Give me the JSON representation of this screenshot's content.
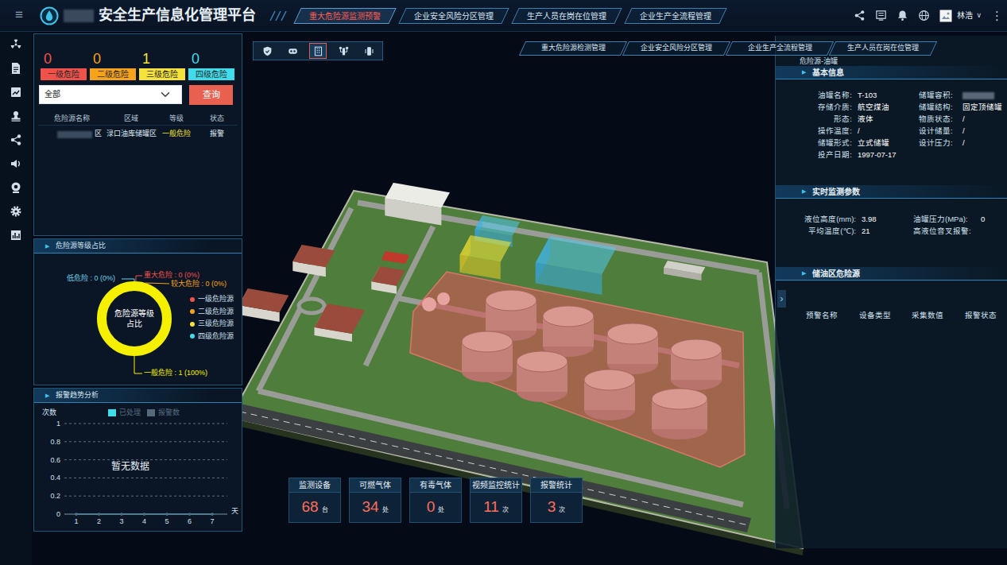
{
  "header": {
    "menu_icon": "≡",
    "title_redacted": true,
    "title": "安全生产信息化管理平台",
    "user": "林浩",
    "user_caret": "∨",
    "more_icon": "⋮"
  },
  "nav_tabs": [
    {
      "label": "重大危险源监测预警",
      "selected": true
    },
    {
      "label": "企业安全风险分区管理",
      "selected": false
    },
    {
      "label": "生产人员在岗在位管理",
      "selected": false
    },
    {
      "label": "企业生产全流程管理",
      "selected": false
    }
  ],
  "section_marker": "▶",
  "risk_counts": [
    {
      "count": "0",
      "label": "一级危险",
      "color": "#f0524a"
    },
    {
      "count": "0",
      "label": "二级危险",
      "color": "#f7a21b"
    },
    {
      "count": "1",
      "label": "三级危险",
      "color": "#f5e23a"
    },
    {
      "count": "0",
      "label": "四级危险",
      "color": "#3fdcec"
    }
  ],
  "filter": {
    "value": "全部",
    "button": "查询"
  },
  "risk_table": {
    "columns": [
      "危险源名称",
      "区域",
      "等级",
      "状态"
    ],
    "rows": [
      {
        "name_redacted": true,
        "cells": [
          "区",
          "渌口油库储罐区",
          "一般危险",
          "报警"
        ],
        "color": "#f5e23a"
      }
    ]
  },
  "ratio_chart": {
    "title": "危险源等级占比",
    "center": [
      "危险源等级",
      "占比"
    ],
    "segments": [
      {
        "label": "低危险 : 0 (0%)",
        "value": 0,
        "color": "#6fd3e6"
      },
      {
        "label": "重大危险 : 0 (0%)",
        "value": 0,
        "color": "#f0524a"
      },
      {
        "label": "较大危险 : 0 (0%)",
        "value": 0,
        "color": "#f7a21b"
      },
      {
        "label": "一般危险 : 1 (100%)",
        "value": 1,
        "color": "#f5f000"
      }
    ],
    "legend": [
      {
        "label": "一级危险源",
        "color": "#f0524a"
      },
      {
        "label": "二级危险源",
        "color": "#f7a21b"
      },
      {
        "label": "三级危险源",
        "color": "#f5e23a"
      },
      {
        "label": "四级危险源",
        "color": "#3fdcec"
      }
    ]
  },
  "trend_chart": {
    "title": "报警趋势分析",
    "y_label": "次数",
    "y_ticks": [
      "1",
      "0.8",
      "0.6",
      "0.4",
      "0.2",
      "0"
    ],
    "x_ticks": [
      "1",
      "2",
      "3",
      "4",
      "5",
      "6",
      "7"
    ],
    "x_unit": "天",
    "empty_text": "暂无数据",
    "series": [
      {
        "name": "已处理",
        "color": "#3fdcec",
        "values": [
          0,
          0,
          0,
          0,
          0,
          0,
          0
        ]
      },
      {
        "name": "报警数",
        "color": "#56697c",
        "values": [
          0,
          0,
          0,
          0,
          0,
          0,
          0
        ]
      }
    ]
  },
  "toolbar": [
    {
      "selected": false
    },
    {
      "selected": false
    },
    {
      "selected": true
    },
    {
      "selected": false
    },
    {
      "selected": false
    }
  ],
  "sub_tabs": [
    "重大危险源检测管理",
    "企业安全风险分区管理",
    "企业生产全流程管理",
    "生产人员在岗在位管理"
  ],
  "detail": {
    "title": "危险源-油罐",
    "handle": "›",
    "basic": {
      "title": "基本信息",
      "fields": [
        {
          "label": "油罐名称:",
          "value": "T-103",
          "redacted": false
        },
        {
          "label": "储罐容积:",
          "value": "",
          "redacted": true
        },
        {
          "label": "存储介质:",
          "value": "航空煤油",
          "redacted": false
        },
        {
          "label": "储罐结构:",
          "value": "固定顶储罐",
          "redacted": false
        },
        {
          "label": "形态:",
          "value": "液体",
          "redacted": false
        },
        {
          "label": "物质状态:",
          "value": "/",
          "redacted": false
        },
        {
          "label": "操作温度:",
          "value": "/",
          "redacted": false
        },
        {
          "label": "设计储量:",
          "value": "/",
          "redacted": false
        },
        {
          "label": "储罐形式:",
          "value": "立式储罐",
          "redacted": false
        },
        {
          "label": "设计压力:",
          "value": "/",
          "redacted": false
        },
        {
          "label": "投产日期:",
          "value": "1997-07-17",
          "redacted": false
        }
      ]
    },
    "monitor": {
      "title": "实时监测参数",
      "fields": [
        {
          "label": "液位高度(mm):",
          "value": "3.98"
        },
        {
          "label": "油罐压力(MPa):",
          "value": "0"
        },
        {
          "label": "平均温度(℃):",
          "value": "21"
        },
        {
          "label": "高液位音叉报警:",
          "value": ""
        }
      ]
    },
    "hazards": {
      "title": "储油区危险源",
      "columns": [
        "预警名称",
        "设备类型",
        "采集数值",
        "报警状态"
      ],
      "rows": []
    }
  },
  "stats": [
    {
      "label": "监测设备",
      "value": "68",
      "unit": "台"
    },
    {
      "label": "可燃气体",
      "value": "34",
      "unit": "处"
    },
    {
      "label": "有毒气体",
      "value": "0",
      "unit": "处"
    },
    {
      "label": "视频监控统计",
      "value": "11",
      "unit": "次"
    },
    {
      "label": "报警统计",
      "value": "3",
      "unit": "次"
    }
  ]
}
